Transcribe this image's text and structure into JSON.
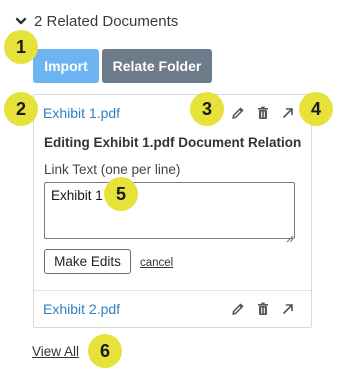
{
  "section": {
    "title": "2 Related Documents",
    "icon": "chevron-down-icon"
  },
  "buttons": {
    "import": "Import",
    "relate_folder": "Relate Folder"
  },
  "documents": [
    {
      "name": "Exhibit 1.pdf",
      "actions": [
        "pencil-icon",
        "trash-icon",
        "external-link-icon"
      ]
    },
    {
      "name": "Exhibit 2.pdf",
      "actions": [
        "pencil-icon",
        "trash-icon",
        "external-link-icon"
      ]
    }
  ],
  "edit_panel": {
    "title": "Editing Exhibit 1.pdf Document Relation",
    "field_label": "Link Text (one per line)",
    "field_value": "Exhibit 1",
    "make_edits": "Make Edits",
    "cancel": "cancel"
  },
  "footer": {
    "view_all": "View All"
  },
  "callouts": [
    "1",
    "2",
    "3",
    "4",
    "5",
    "6"
  ],
  "colors": {
    "import_button": "#6cb4f2",
    "relate_button": "#6e7b8a",
    "link": "#2f7fc1",
    "callout": "#e6e23a"
  }
}
